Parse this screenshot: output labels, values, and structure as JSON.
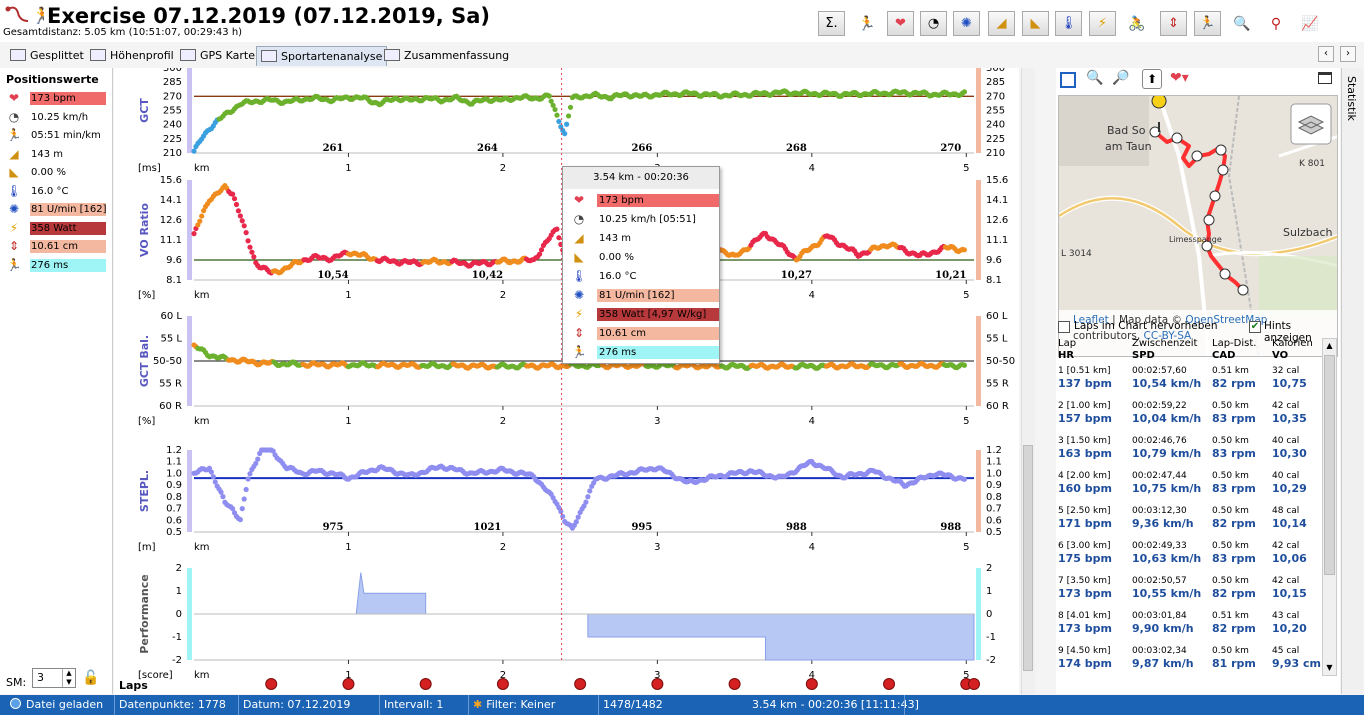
{
  "header": {
    "title": "Exercise 07.12.2019 (07.12.2019, Sa)",
    "subtitle": "Gesamtdistanz: 5.05 km (10:51:07, 00:29:43 h)"
  },
  "toolbar": {
    "sigma_label": "Σ."
  },
  "tabs": [
    {
      "label": "Gesplittet"
    },
    {
      "label": "Höhenprofil"
    },
    {
      "label": "GPS Karte"
    },
    {
      "label": "Sportartenanalyse"
    },
    {
      "label": "Zusammenfassung"
    }
  ],
  "position_values": {
    "title": "Positionswerte",
    "items": [
      {
        "icon": "heart-icon",
        "value": "173 bpm",
        "color": "#f06a6a"
      },
      {
        "icon": "speed-icon",
        "value": "10.25 km/h",
        "color": ""
      },
      {
        "icon": "pace-icon",
        "value": "05:51 min/km",
        "color": ""
      },
      {
        "icon": "altitude-icon",
        "value": "143 m",
        "color": ""
      },
      {
        "icon": "slope-icon",
        "value": "0.00 %",
        "color": ""
      },
      {
        "icon": "temperature-icon",
        "value": "16.0 °C",
        "color": ""
      },
      {
        "icon": "cadence-icon",
        "value": "81 U/min [162]",
        "color": "#f4b7a0"
      },
      {
        "icon": "power-icon",
        "value": "358 Watt",
        "color": "#b8393b"
      },
      {
        "icon": "vertical-oscillation-icon",
        "value": "10.61 cm",
        "color": "#f4b7a0"
      },
      {
        "icon": "gct-icon",
        "value": "276 ms",
        "color": "#9ff5f5"
      }
    ],
    "sm_label": "SM:",
    "sm_value": "3"
  },
  "charts": {
    "x_unit": "km",
    "x_ticks": [
      "1",
      "2",
      "3",
      "4",
      "5"
    ],
    "laps_label": "Laps",
    "panels": [
      {
        "label": "GCT",
        "unit": "[ms]",
        "ticks": [
          "300",
          "285",
          "270",
          "255",
          "240",
          "225",
          "210"
        ],
        "lap_values": [
          "261",
          "264",
          "266",
          "268",
          "270"
        ]
      },
      {
        "label": "VO Ratio",
        "unit": "[%]",
        "ticks": [
          "15.6",
          "14.1",
          "12.6",
          "11.1",
          "9.6",
          "8.1"
        ],
        "lap_values": [
          "10,54",
          "10,42",
          "",
          "10,27",
          "10,21"
        ]
      },
      {
        "label": "GCT Bal.",
        "unit": "[%]",
        "ticks": [
          "60 L",
          "55 L",
          "50-50",
          "55 R",
          "60 R"
        ],
        "lap_values": []
      },
      {
        "label": "STEPL.",
        "unit": "[m]",
        "ticks": [
          "1.2",
          "1.1",
          "1.0",
          "0.9",
          "0.8",
          "0.7",
          "0.6",
          "0.5"
        ],
        "lap_values": [
          "975",
          "1021",
          "995",
          "988",
          "988"
        ]
      },
      {
        "label": "Performance",
        "unit": "[score]",
        "ticks": [
          "2",
          "1",
          "0",
          "-1",
          "-2"
        ],
        "lap_values": []
      }
    ]
  },
  "chart_data": [
    {
      "type": "scatter",
      "title": "",
      "ylabel": "GCT",
      "yunit": "ms",
      "ylim": [
        210,
        300
      ],
      "xlim": [
        0,
        5.05
      ],
      "reference": 270,
      "x": [
        0.0,
        0.05,
        0.1,
        0.15,
        0.2,
        0.25,
        0.3,
        0.4,
        0.5,
        0.6,
        0.7,
        0.8,
        0.9,
        1.0,
        1.1,
        1.2,
        1.3,
        1.4,
        1.5,
        1.6,
        1.7,
        1.8,
        1.9,
        2.0,
        2.1,
        2.2,
        2.3,
        2.35,
        2.4,
        2.45,
        2.5,
        2.6,
        2.7,
        2.8,
        2.9,
        3.0,
        3.2,
        3.4,
        3.6,
        3.8,
        4.0,
        4.2,
        4.4,
        4.6,
        4.8,
        5.0
      ],
      "y": [
        212,
        225,
        236,
        244,
        250,
        256,
        262,
        265,
        266,
        264,
        267,
        268,
        266,
        269,
        268,
        262,
        268,
        266,
        268,
        266,
        268,
        263,
        267,
        266,
        269,
        268,
        270,
        250,
        230,
        268,
        270,
        271,
        269,
        272,
        270,
        272,
        273,
        271,
        272,
        274,
        273,
        272,
        273,
        274,
        272,
        273
      ]
    },
    {
      "type": "scatter",
      "title": "",
      "ylabel": "VO Ratio",
      "yunit": "%",
      "ylim": [
        8.1,
        15.6
      ],
      "xlim": [
        0,
        5.05
      ],
      "reference": 9.6,
      "x": [
        0.0,
        0.1,
        0.2,
        0.25,
        0.3,
        0.35,
        0.4,
        0.5,
        0.6,
        0.7,
        0.8,
        0.9,
        1.0,
        1.1,
        1.2,
        1.4,
        1.6,
        1.8,
        2.0,
        2.2,
        2.35,
        2.4,
        2.5,
        2.7,
        2.9,
        3.1,
        3.3,
        3.5,
        3.7,
        3.9,
        4.1,
        4.3,
        4.5,
        4.7,
        4.9,
        5.0
      ],
      "y": [
        11.5,
        14.2,
        15.0,
        14.6,
        13.0,
        11.0,
        9.4,
        8.6,
        9.0,
        9.6,
        9.8,
        9.7,
        10.2,
        9.9,
        9.6,
        9.4,
        9.5,
        9.3,
        9.5,
        9.6,
        12.0,
        9.8,
        9.7,
        9.8,
        10.2,
        10.4,
        11.2,
        9.8,
        11.6,
        9.7,
        11.4,
        10.0,
        10.8,
        9.9,
        10.6,
        10.2
      ]
    },
    {
      "type": "scatter",
      "title": "",
      "ylabel": "GCT Bal.",
      "yunit": "%",
      "ylim": [
        -60,
        60
      ],
      "xlim": [
        0,
        5.05
      ],
      "reference": 0,
      "x": [
        0.0,
        0.1,
        0.2,
        0.4,
        0.6,
        0.8,
        1.0,
        1.5,
        2.0,
        2.5,
        3.0,
        3.5,
        4.0,
        4.5,
        5.0
      ],
      "y": [
        20,
        8,
        3,
        -2,
        -4,
        -5,
        -5,
        -6,
        -7,
        -6,
        -6,
        -7,
        -7,
        -6,
        -6
      ]
    },
    {
      "type": "scatter",
      "title": "",
      "ylabel": "STEPL.",
      "yunit": "m",
      "ylim": [
        0.5,
        1.2
      ],
      "xlim": [
        0,
        5.05
      ],
      "reference": 0.96,
      "x": [
        0.0,
        0.1,
        0.2,
        0.25,
        0.3,
        0.35,
        0.4,
        0.45,
        0.5,
        0.6,
        0.7,
        0.8,
        0.9,
        1.0,
        1.2,
        1.4,
        1.6,
        1.8,
        2.0,
        2.2,
        2.35,
        2.4,
        2.45,
        2.6,
        2.8,
        3.0,
        3.2,
        3.4,
        3.6,
        3.8,
        4.0,
        4.2,
        4.4,
        4.6,
        4.8,
        5.0
      ],
      "y": [
        1.0,
        1.05,
        0.75,
        0.7,
        0.6,
        0.95,
        1.1,
        1.25,
        1.2,
        1.05,
        1.0,
        1.02,
        1.0,
        0.96,
        1.05,
        0.98,
        1.06,
        1.0,
        1.03,
        0.98,
        0.75,
        0.6,
        0.52,
        0.95,
        1.0,
        1.05,
        0.92,
        0.98,
        1.02,
        0.96,
        1.1,
        0.97,
        1.02,
        0.9,
        1.0,
        0.95
      ]
    },
    {
      "type": "area",
      "title": "",
      "ylabel": "Performance",
      "yunit": "score",
      "ylim": [
        -2,
        2
      ],
      "xlim": [
        0,
        5.05
      ],
      "x": [
        0.0,
        1.05,
        1.05,
        1.08,
        1.1,
        1.5,
        1.5,
        2.55,
        2.55,
        3.7,
        3.7,
        5.05
      ],
      "y": [
        0,
        0,
        0,
        1.8,
        0.9,
        0.9,
        0,
        0,
        -1,
        -1,
        -2,
        -2
      ]
    }
  ],
  "tooltip": {
    "header": "3.54 km - 00:20:36",
    "rows": [
      {
        "icon": "heart-icon",
        "value": "173 bpm",
        "color": "#f06a6a"
      },
      {
        "icon": "speed-icon",
        "value": "10.25 km/h [05:51]",
        "color": ""
      },
      {
        "icon": "altitude-icon",
        "value": "143 m",
        "color": ""
      },
      {
        "icon": "slope-icon",
        "value": "0.00 %",
        "color": ""
      },
      {
        "icon": "temperature-icon",
        "value": "16.0 °C",
        "color": ""
      },
      {
        "icon": "cadence-icon",
        "value": "81 U/min [162]",
        "color": "#f4b7a0"
      },
      {
        "icon": "power-icon",
        "value": "358 Watt [4,97 W/kg]",
        "color": "#b8393b"
      },
      {
        "icon": "vertical-oscillation-icon",
        "value": "10.61 cm",
        "color": "#f4b7a0"
      },
      {
        "icon": "gct-icon",
        "value": "276 ms",
        "color": "#9ff5f5"
      }
    ]
  },
  "map": {
    "labels": [
      "Bad So",
      "am Taun",
      "K 801",
      "Limesspange",
      "Sulzbach",
      "L 3014"
    ],
    "attr_leaflet": "Leaflet",
    "attr_mid": " | Map data © ",
    "attr_osm": "OpenStreetMap",
    "attr_tail": " contributors, ",
    "attr_cc": "CC-BY-SA"
  },
  "laps_panel": {
    "highlight_label": "Laps im Chart hervorheben",
    "hints_label": "Hints anzeigen",
    "headers": {
      "lap": "Lap",
      "hr": "HR",
      "split": "Zwischenzeit",
      "spd": "SPD",
      "dist": "Lap-Dist.",
      "cad": "CAD",
      "cal": "Kalorien",
      "vo": "VO"
    },
    "rows": [
      {
        "lap": "1 [0.51 km]",
        "split": "00:02:57,60",
        "dist": "0.51 km",
        "cal": "32 cal",
        "hr": "137 bpm",
        "spd": "10,54 km/h",
        "cad": "82 rpm",
        "vo": "10,75"
      },
      {
        "lap": "2 [1.00 km]",
        "split": "00:02:59,22",
        "dist": "0.50 km",
        "cal": "42 cal",
        "hr": "157 bpm",
        "spd": "10,04 km/h",
        "cad": "83 rpm",
        "vo": "10,35"
      },
      {
        "lap": "3 [1.50 km]",
        "split": "00:02:46,76",
        "dist": "0.50 km",
        "cal": "40 cal",
        "hr": "163 bpm",
        "spd": "10,79 km/h",
        "cad": "83 rpm",
        "vo": "10,30"
      },
      {
        "lap": "4 [2.00 km]",
        "split": "00:02:47,44",
        "dist": "0.50 km",
        "cal": "40 cal",
        "hr": "160 bpm",
        "spd": "10,75 km/h",
        "cad": "83 rpm",
        "vo": "10,29"
      },
      {
        "lap": "5 [2.50 km]",
        "split": "00:03:12,30",
        "dist": "0.50 km",
        "cal": "48 cal",
        "hr": "171 bpm",
        "spd": "9,36 km/h",
        "cad": "82 rpm",
        "vo": "10,14"
      },
      {
        "lap": "6 [3.00 km]",
        "split": "00:02:49,33",
        "dist": "0.50 km",
        "cal": "42 cal",
        "hr": "175 bpm",
        "spd": "10,63 km/h",
        "cad": "83 rpm",
        "vo": "10,06"
      },
      {
        "lap": "7 [3.50 km]",
        "split": "00:02:50,57",
        "dist": "0.50 km",
        "cal": "42 cal",
        "hr": "173 bpm",
        "spd": "10,55 km/h",
        "cad": "82 rpm",
        "vo": "10,15"
      },
      {
        "lap": "8 [4.01 km]",
        "split": "00:03:01,84",
        "dist": "0.51 km",
        "cal": "43 cal",
        "hr": "173 bpm",
        "spd": "9,90 km/h",
        "cad": "82 rpm",
        "vo": "10,20"
      },
      {
        "lap": "9 [4.50 km]",
        "split": "00:03:02,34",
        "dist": "0.50 km",
        "cal": "45 cal",
        "hr": "174 bpm",
        "spd": "9,87 km/h",
        "cad": "81 rpm",
        "vo": "9,93 cm"
      }
    ]
  },
  "side_tab": "Statistik",
  "status": {
    "loaded": "Datei geladen",
    "points": "Datenpunkte: 1778",
    "date": "Datum: 07.12.2019",
    "interval": "Intervall: 1",
    "filter": "Filter: Keiner",
    "count": "1478/1482",
    "position": "3.54 km - 00:20:36 [11:11:43]"
  }
}
